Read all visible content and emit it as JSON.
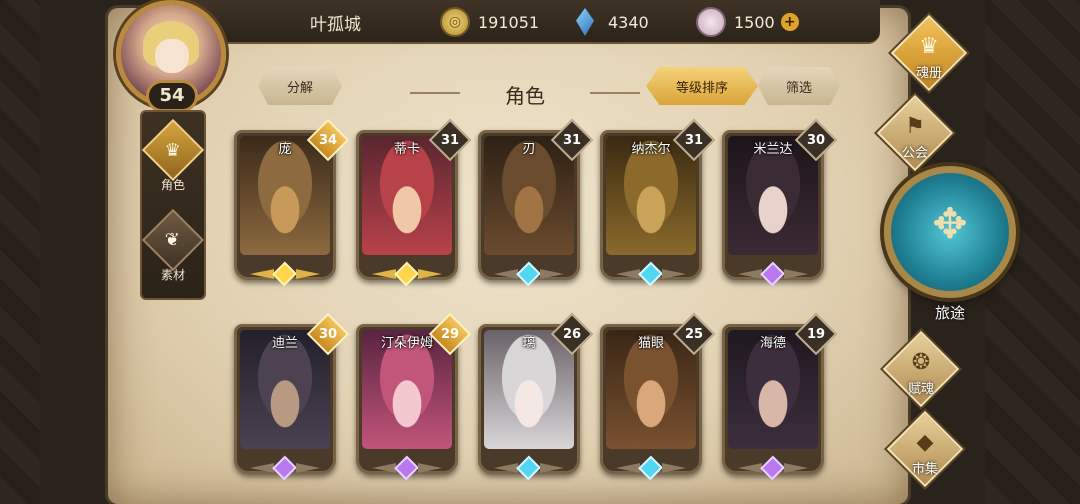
{
  "player": {
    "name": "叶孤城",
    "level": "54"
  },
  "currencies": [
    {
      "icon": "gold-coin-icon",
      "value": "191051"
    },
    {
      "icon": "blue-crystal-icon",
      "value": "4340"
    },
    {
      "icon": "pink-gem-icon",
      "value": "1500"
    }
  ],
  "side_menu": [
    {
      "label": "角色",
      "icon": "character-helmet-icon",
      "active": true
    },
    {
      "label": "素材",
      "icon": "material-wings-icon",
      "active": false
    }
  ],
  "header": {
    "decompose": "分解",
    "title": "角色",
    "sort_level": "等级排序",
    "filter": "筛选"
  },
  "characters": [
    {
      "name": "庞",
      "level": "34",
      "rank": "gold",
      "palette": [
        "#8d6a40",
        "#c79a5c",
        "#3b2a1a"
      ]
    },
    {
      "name": "蒂卡",
      "level": "31",
      "rank": "gold",
      "palette": [
        "#b8424a",
        "#f0c8a8",
        "#5a2630"
      ]
    },
    {
      "name": "刃",
      "level": "31",
      "rank": "cyan",
      "palette": [
        "#6b4b2e",
        "#a07444",
        "#2d2015"
      ]
    },
    {
      "name": "纳杰尔",
      "level": "31",
      "rank": "cyan",
      "palette": [
        "#8b6a2c",
        "#c9a35a",
        "#3a2a12"
      ]
    },
    {
      "name": "米兰达",
      "level": "30",
      "rank": "purple",
      "palette": [
        "#3a2a34",
        "#e9d2cc",
        "#1e1419"
      ]
    },
    {
      "name": "迪兰",
      "level": "30",
      "rank": "purple",
      "palette": [
        "#4c4252",
        "#b89a82",
        "#22202a"
      ]
    },
    {
      "name": "汀朵伊姆",
      "level": "29",
      "rank": "purple",
      "palette": [
        "#c2557a",
        "#f3c8cf",
        "#5a2440"
      ]
    },
    {
      "name": "璃",
      "level": "26",
      "rank": "cyan",
      "palette": [
        "#d9d6d8",
        "#f5e8e4",
        "#6a6268"
      ]
    },
    {
      "name": "猫眼",
      "level": "25",
      "rank": "cyan",
      "palette": [
        "#7a5230",
        "#d9a77c",
        "#3a2616"
      ]
    },
    {
      "name": "海德",
      "level": "19",
      "rank": "purple",
      "palette": [
        "#3d2e3d",
        "#d8b7a9",
        "#1f1820"
      ]
    }
  ],
  "right_menu": [
    {
      "label": "魂册",
      "icon": "soul-book-icon",
      "highlight": true
    },
    {
      "label": "公会",
      "icon": "guild-icon",
      "highlight": false
    },
    {
      "label": "赋魂",
      "icon": "soul-infuse-icon",
      "highlight": false
    },
    {
      "label": "市集",
      "icon": "market-icon",
      "highlight": false
    }
  ],
  "journey": {
    "label": "旅途",
    "icon": "journey-compass-icon"
  }
}
